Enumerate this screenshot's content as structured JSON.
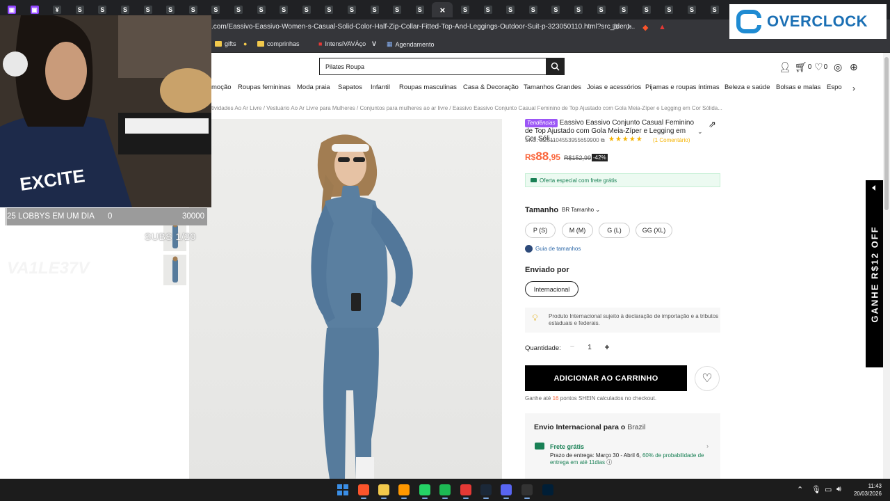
{
  "browser": {
    "tabs": [
      {
        "icon": "twitch-icon",
        "glyph": "▣"
      },
      {
        "icon": "twitch-icon",
        "glyph": "▣"
      },
      {
        "icon": "tab-favicon",
        "glyph": "¥"
      },
      {
        "icon": "s-icon",
        "glyph": "S"
      },
      {
        "icon": "s-icon",
        "glyph": "S"
      },
      {
        "icon": "s-icon",
        "glyph": "S"
      },
      {
        "icon": "s-icon",
        "glyph": "S"
      },
      {
        "icon": "s-icon",
        "glyph": "S"
      },
      {
        "icon": "s-icon",
        "glyph": "S"
      },
      {
        "icon": "s-icon",
        "glyph": "S"
      },
      {
        "icon": "s-icon",
        "glyph": "S"
      },
      {
        "icon": "s-icon",
        "glyph": "S"
      },
      {
        "icon": "s-icon",
        "glyph": "S"
      },
      {
        "icon": "s-icon",
        "glyph": "S"
      },
      {
        "icon": "s-icon",
        "glyph": "S"
      },
      {
        "icon": "s-icon",
        "glyph": "S"
      },
      {
        "icon": "s-icon",
        "glyph": "S"
      },
      {
        "icon": "s-icon",
        "glyph": "S"
      },
      {
        "icon": "s-icon",
        "glyph": "S"
      },
      {
        "icon": "close-icon",
        "glyph": "×"
      },
      {
        "icon": "s-icon",
        "glyph": "S"
      },
      {
        "icon": "s-icon",
        "glyph": "S"
      },
      {
        "icon": "s-icon",
        "glyph": "S"
      },
      {
        "icon": "s-icon",
        "glyph": "S"
      },
      {
        "icon": "s-icon",
        "glyph": "S"
      },
      {
        "icon": "s-icon",
        "glyph": "S"
      },
      {
        "icon": "s-icon",
        "glyph": "S"
      },
      {
        "icon": "s-icon",
        "glyph": "S"
      },
      {
        "icon": "s-icon",
        "glyph": "S"
      },
      {
        "icon": "s-icon",
        "glyph": "S"
      },
      {
        "icon": "s-icon",
        "glyph": "S"
      },
      {
        "icon": "s-icon",
        "glyph": "S"
      }
    ],
    "url": ".com/Eassivo-Eassivo-Women-s-Casual-Solid-Color-Half-Zip-Collar-Fitted-Top-And-Leggings-Outdoor-Suit-p-323050110.html?src_ident...",
    "bookmarks": [
      {
        "label": "gifts",
        "icon": "folder-icon"
      },
      {
        "label": "",
        "icon": "dot-icon"
      },
      {
        "label": "comprinhas",
        "icon": "folder-icon"
      },
      {
        "label": "IntensiVAVÁço",
        "icon": "bookmark-favicon"
      },
      {
        "label": "",
        "icon": "v-icon"
      },
      {
        "label": "Agendamento",
        "icon": "calendar-icon"
      }
    ]
  },
  "overlay": {
    "brand": "OVERCLOCK",
    "lobby_label": "25 LOBBYS EM UM DIA",
    "lobby_current": "0",
    "lobby_goal": "30000",
    "lobby_progress": 0,
    "subs": "SUBS 1/20",
    "ghost_text": "VA1LE37V"
  },
  "site": {
    "search_value": "Pilates Roupa",
    "header_counts": {
      "cart": "0",
      "wishlist": "0"
    },
    "nav": [
      "moção",
      "Roupas femininas",
      "Moda praia",
      "Sapatos",
      "Infantil",
      "Roupas masculinas",
      "Casa & Decoração",
      "Tamanhos Grandes",
      "Joias e acessórios",
      "Pijamas e roupas íntimas",
      "Beleza e saúde",
      "Bolsas e malas",
      "Espo"
    ],
    "breadcrumb": "tividades Ao Ar Livre /  Vestuário Ao Ar Livre para Mulheres /  Conjuntos para mulheres ao ar livre /  Eassivo Eassivo Conjunto Casual Feminino de Top Ajustado com Gola Meia-Zíper e Legging em Cor Sólida..."
  },
  "product": {
    "badge": "Tendências",
    "title": "Eassivo Eassivo Conjunto Casual Feminino de Top Ajustado com Gola Meia-Zíper e Legging em Cor Sóli...",
    "sku": "SKU: st2511045539556599​00",
    "rating": 5,
    "stars": "★★★★★",
    "reviews": "(1 Comentário)",
    "price_currency": "R$",
    "price_int": "88",
    "price_dec": ",95",
    "old_price": "R$152,99",
    "discount": "-42%",
    "offer": "Oferta especial com frete grátis",
    "size_label": "Tamanho",
    "size_selector": "BR Tamanho",
    "sizes": [
      "P (S)",
      "M (M)",
      "G (L)",
      "GG (XL)"
    ],
    "size_guide": "Guia de tamanhos",
    "ship_label": "Enviado por",
    "ship_option": "Internacional",
    "notice": "Produto Internacional sujeito à declaração de importação e a tributos estaduais e federais.",
    "qty_label": "Quantidade:",
    "qty_minus": "−",
    "qty_value": "1",
    "qty_plus": "+",
    "add_to_cart": "ADICIONAR AO CARRINHO",
    "points_pre": "Ganhe até",
    "points_num": "16",
    "points_post": "pontos SHEIN calculados no checkout.",
    "shipping": {
      "heading_bold": "Envio Internacional para o",
      "heading_country": "Brazil",
      "free": "Frete grátis",
      "delivery_pre": "Prazo de entrega: Março 30 - Abril 6,",
      "delivery_prob": "60% de probabilidade de entrega em até 11dias",
      "info": "ⓘ"
    },
    "side_banner": "GANHE R$12 OFF"
  },
  "taskbar": {
    "time": "11:43",
    "date": "20/03/2026",
    "apps": [
      {
        "icon": "windows-start-icon",
        "color": "#3a8ee6"
      },
      {
        "icon": "brave-browser-icon",
        "color": "#fb542b"
      },
      {
        "icon": "file-explorer-icon",
        "color": "#f2c94c"
      },
      {
        "icon": "sublime-text-icon",
        "color": "#ff9800"
      },
      {
        "icon": "whatsapp-icon",
        "color": "#25d366"
      },
      {
        "icon": "spotify-icon",
        "color": "#1db954"
      },
      {
        "icon": "app-red-icon",
        "color": "#e53935"
      },
      {
        "icon": "steam-icon",
        "color": "#1b2838"
      },
      {
        "icon": "discord-icon",
        "color": "#5865f2"
      },
      {
        "icon": "obs-icon",
        "color": "#333333"
      },
      {
        "icon": "photoshop-icon",
        "color": "#001e36"
      }
    ]
  }
}
